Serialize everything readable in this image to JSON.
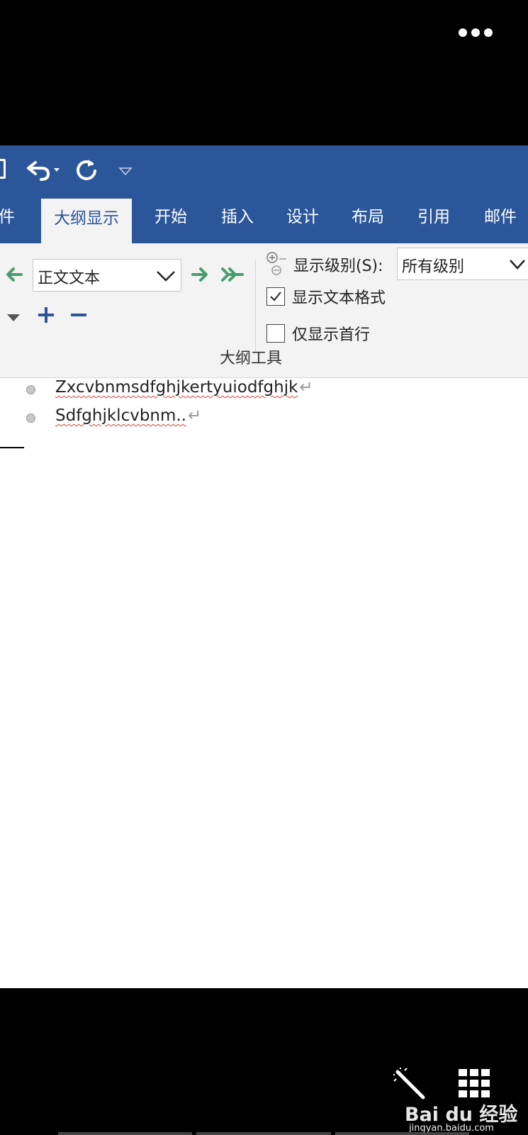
{
  "viewer": {
    "more_label": "•••"
  },
  "tabs": [
    {
      "label": "件"
    },
    {
      "label": "大纲显示",
      "active": true
    },
    {
      "label": "开始"
    },
    {
      "label": "插入"
    },
    {
      "label": "设计"
    },
    {
      "label": "布局"
    },
    {
      "label": "引用"
    },
    {
      "label": "邮件"
    }
  ],
  "outline": {
    "level_value": "正文文本",
    "show_level_label": "显示级别(S):",
    "show_level_value": "所有级别",
    "show_text_format_label": "显示文本格式",
    "show_text_format_checked": true,
    "show_first_line_label": "仅显示首行",
    "show_first_line_checked": false,
    "group_label": "大纲工具"
  },
  "document": {
    "lines": [
      {
        "text": "Zxcvbnmsdfghjkertyuiodfghjk",
        "mark": "↵"
      },
      {
        "text": "Sdfghjklcvbnm..",
        "mark": "↵"
      }
    ]
  },
  "watermark": {
    "brand": "Bai du 经验",
    "site": "jingyan.baidu.com"
  },
  "colors": {
    "ribbon_blue": "#2b579a",
    "arrow_green": "#4a9c6d",
    "spell_red": "#e0403a"
  }
}
